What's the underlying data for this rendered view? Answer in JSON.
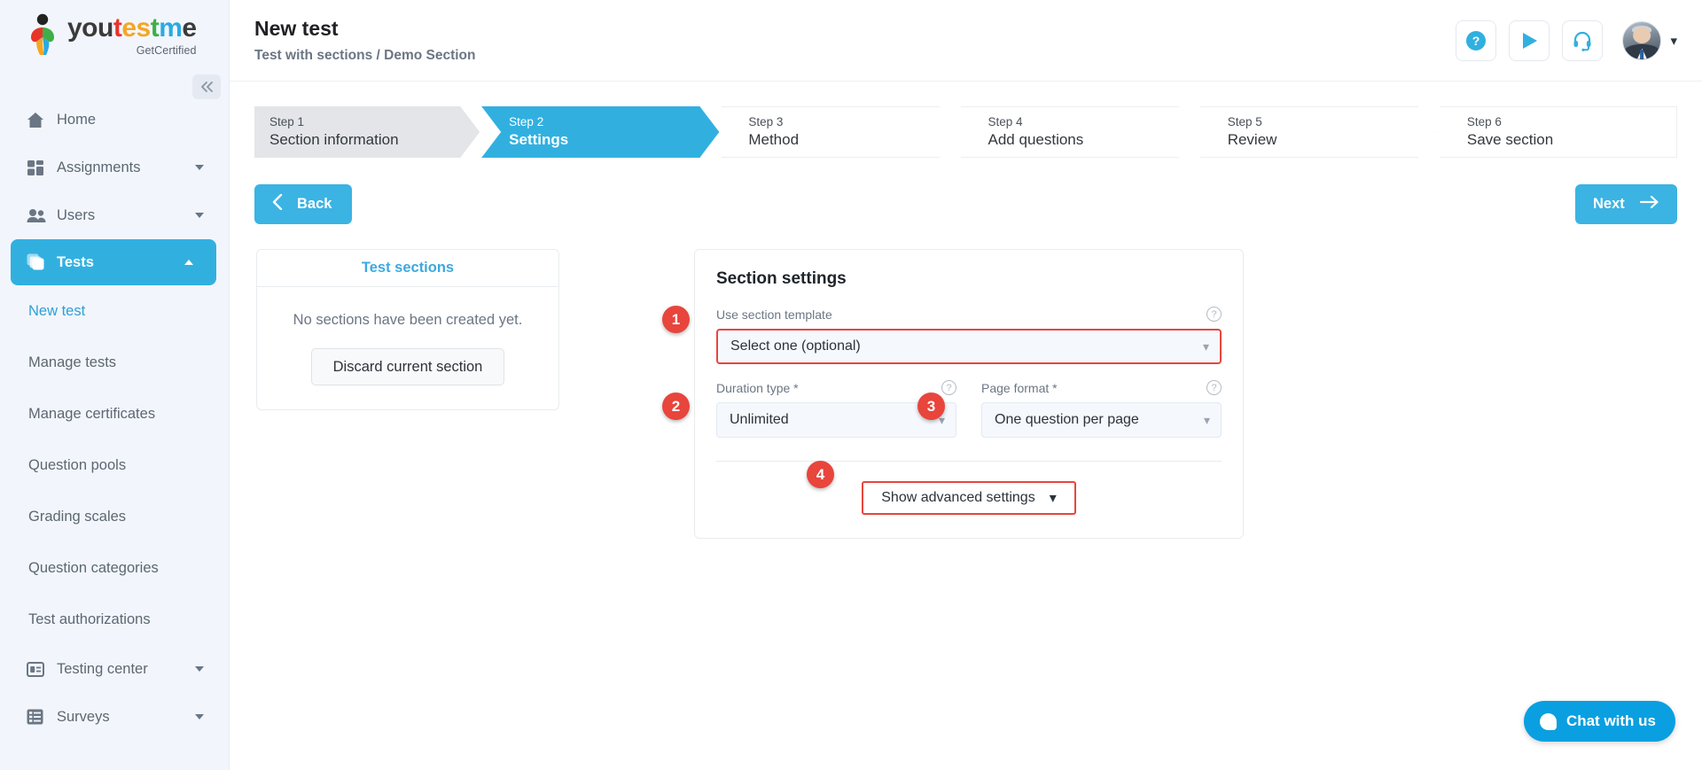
{
  "sidebar": {
    "logo": {
      "word_parts": [
        "you",
        "t",
        "es",
        "t",
        "m",
        "e"
      ],
      "subtitle": "GetCertified"
    },
    "collapse_icon": "chevron-double-left",
    "items": [
      {
        "label": "Home",
        "icon": "home-icon",
        "has_caret": false,
        "active": false
      },
      {
        "label": "Assignments",
        "icon": "assignments-icon",
        "has_caret": true,
        "active": false
      },
      {
        "label": "Users",
        "icon": "users-icon",
        "has_caret": true,
        "active": false
      },
      {
        "label": "Tests",
        "icon": "tests-icon",
        "has_caret": true,
        "active": true
      }
    ],
    "sub_items": [
      {
        "label": "New test",
        "current": true
      },
      {
        "label": "Manage tests",
        "current": false
      },
      {
        "label": "Manage certificates",
        "current": false
      },
      {
        "label": "Question pools",
        "current": false
      },
      {
        "label": "Grading scales",
        "current": false
      },
      {
        "label": "Question categories",
        "current": false
      },
      {
        "label": "Test authorizations",
        "current": false
      }
    ],
    "bottom_items": [
      {
        "label": "Testing center",
        "icon": "testing-center-icon",
        "has_caret": true
      },
      {
        "label": "Surveys",
        "icon": "surveys-icon",
        "has_caret": true
      }
    ]
  },
  "header": {
    "title": "New test",
    "breadcrumb": "Test with sections / Demo Section",
    "actions": [
      {
        "name": "help-icon",
        "glyph": "?"
      },
      {
        "name": "play-icon",
        "glyph": "▶"
      },
      {
        "name": "support-headset-icon",
        "glyph": "♫"
      }
    ]
  },
  "stepper": [
    {
      "num": "Step 1",
      "name": "Section information",
      "state": "done"
    },
    {
      "num": "Step 2",
      "name": "Settings",
      "state": "active"
    },
    {
      "num": "Step 3",
      "name": "Method",
      "state": "todo"
    },
    {
      "num": "Step 4",
      "name": "Add questions",
      "state": "todo"
    },
    {
      "num": "Step 5",
      "name": "Review",
      "state": "todo"
    },
    {
      "num": "Step 6",
      "name": "Save section",
      "state": "todo"
    }
  ],
  "nav_buttons": {
    "back": "Back",
    "next": "Next"
  },
  "test_sections_card": {
    "title": "Test sections",
    "empty_message": "No sections have been created yet.",
    "discard_label": "Discard current section"
  },
  "section_settings": {
    "title": "Section settings",
    "template_field": {
      "label": "Use section template",
      "value": "Select one (optional)",
      "badge": "1"
    },
    "duration_field": {
      "label": "Duration type",
      "required": "*",
      "value": "Unlimited",
      "badge": "2"
    },
    "page_format_field": {
      "label": "Page format",
      "required": "*",
      "value": "One question per page",
      "badge": "3"
    },
    "advanced_button": {
      "label": "Show advanced settings",
      "badge": "4"
    }
  },
  "chat_widget": {
    "label": "Chat with us"
  },
  "colors": {
    "accent": "#31b0e0",
    "highlight": "#e8453c",
    "sidebar_bg": "#f2f6fc",
    "chat_bg": "#0a9fe0"
  }
}
